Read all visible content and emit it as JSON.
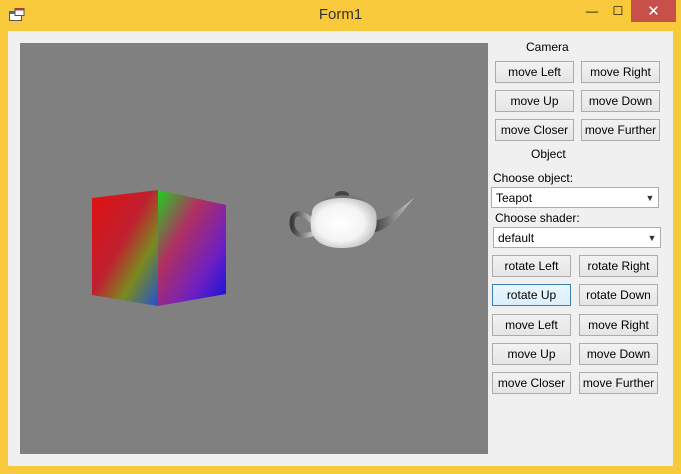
{
  "window": {
    "title": "Form1",
    "min_glyph": "—",
    "max_glyph": "☐",
    "close_glyph": "✕"
  },
  "camera": {
    "heading": "Camera",
    "move_left": "move Left",
    "move_right": "move Right",
    "move_up": "move Up",
    "move_down": "move Down",
    "move_closer": "move Closer",
    "move_further": "move Further"
  },
  "object": {
    "heading": "Object",
    "choose_object_label": "Choose object:",
    "choose_object_value": "Teapot",
    "choose_shader_label": "Choose shader:",
    "choose_shader_value": "default",
    "rotate_left": "rotate Left",
    "rotate_right": "rotate Right",
    "rotate_up": "rotate Up",
    "rotate_down": "rotate Down",
    "move_left": "move Left",
    "move_right": "move Right",
    "move_up": "move Up",
    "move_down": "move Down",
    "move_closer": "move Closer",
    "move_further": "move Further"
  },
  "colors": {
    "frame": "#f9c93c",
    "viewport_bg": "#808080",
    "close_button": "#c7504a"
  }
}
